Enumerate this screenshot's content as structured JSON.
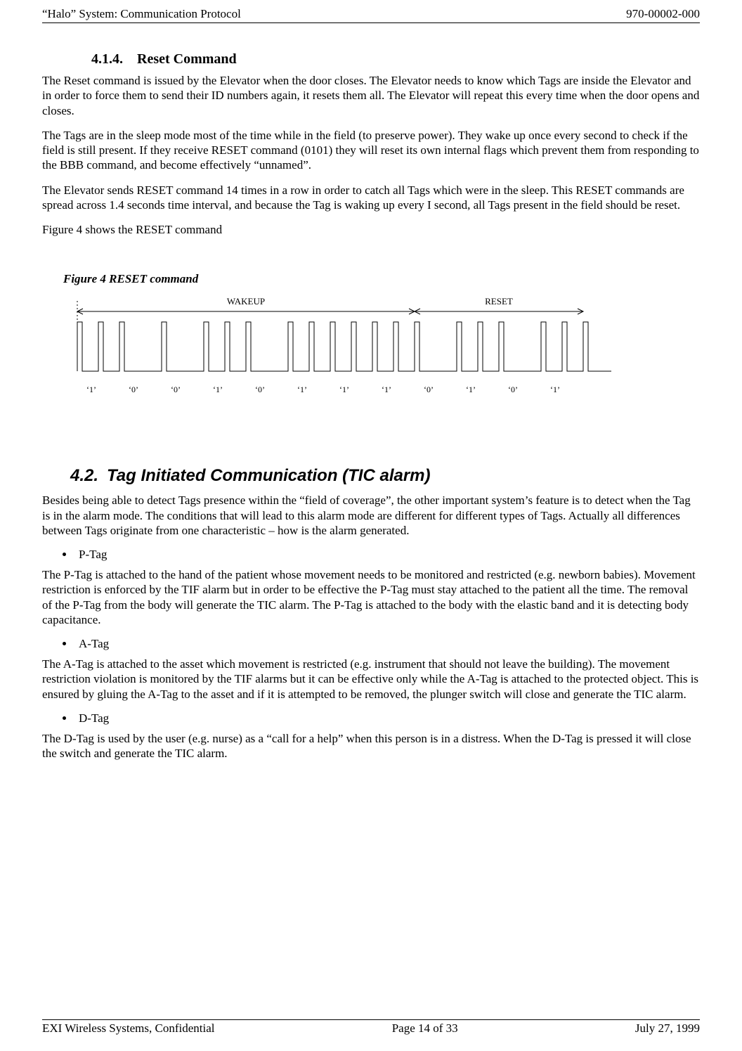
{
  "header": {
    "left": "“Halo” System: Communication Protocol",
    "right": "970-00002-000"
  },
  "footer": {
    "left": "EXI Wireless Systems, Confidential",
    "center": "Page 14 of 33",
    "right": "July 27, 1999"
  },
  "section414": {
    "heading": "4.1.4. Reset Command",
    "p1": "The Reset command is issued by the Elevator when the door closes. The Elevator needs to know which Tags are inside the Elevator and in order to force them to send their ID numbers again, it resets them all. The Elevator will repeat this every time when the door opens and closes.",
    "p2": "The Tags are in the sleep mode most of the time while in the field (to preserve power). They wake up once every second to check if the field is still present. If they receive RESET command (0101) they will reset its own internal flags which prevent them from responding to the BBB command, and become effectively “unnamed”.",
    "p3": "The Elevator sends RESET command 14 times in a row in order to catch all Tags which were in the sleep. This RESET commands are spread across 1.4 seconds time interval, and because the Tag is waking up every I second, all Tags present in the field should be reset.",
    "p4": "Figure 4 shows the RESET command"
  },
  "figure4": {
    "caption": "Figure 4  RESET command",
    "wakeup_label": "WAKEUP",
    "reset_label": "RESET"
  },
  "section42": {
    "heading": "4.2. Tag Initiated Communication (TIC alarm)",
    "p1": "Besides being able to detect Tags presence within the “field of coverage”, the other important system’s feature is to detect when the Tag is in the alarm mode. The conditions that will lead to this alarm mode are different for different types of Tags. Actually all differences between Tags originate from one characteristic – how is the alarm generated.",
    "ptag_label": "P-Tag",
    "ptag_body": "The P-Tag is attached to the hand of the patient whose movement needs to be monitored and restricted (e.g. newborn babies). Movement restriction is enforced by the TIF alarm but in order to be effective the P-Tag must stay attached to the patient all the time. The removal of the P-Tag from the body will generate the TIC alarm. The P-Tag is attached to the body with the elastic band and it is detecting body capacitance.",
    "atag_label": "A-Tag",
    "atag_body": "The A-Tag is attached to the asset which movement is restricted (e.g. instrument that should not leave the building). The movement restriction violation is monitored by the TIF alarms but it can be effective only while the A-Tag is attached to the protected object. This is ensured by gluing the A-Tag to the asset and if it is attempted to be removed, the plunger switch will close and generate the TIC alarm.",
    "dtag_label": "D-Tag",
    "dtag_body": "The D-Tag is used by the user (e.g. nurse) as a “call for a help” when this person is in a distress. When the D-Tag is pressed it will close the switch and generate the TIC alarm."
  },
  "chart_data": {
    "type": "timing",
    "title": "Figure 4  RESET command",
    "sections": [
      {
        "name": "WAKEUP",
        "bits": [
          "1",
          "0",
          "0",
          "1",
          "0",
          "1",
          "1",
          "1"
        ]
      },
      {
        "name": "RESET",
        "bits": [
          "0",
          "1",
          "0",
          "1"
        ]
      }
    ],
    "bit_labels": [
      "‘1’",
      "‘0’",
      "‘0’",
      "‘1’",
      "‘0’",
      "‘1’",
      "‘1’",
      "‘1’",
      "‘0’",
      "‘1’",
      "‘0’",
      "‘1’"
    ],
    "encoding": "Each bit cell is drawn as a narrow high pulse at start, then a second narrow pulse at mid-cell when bit=1, absent when bit=0; baseline low otherwise."
  }
}
